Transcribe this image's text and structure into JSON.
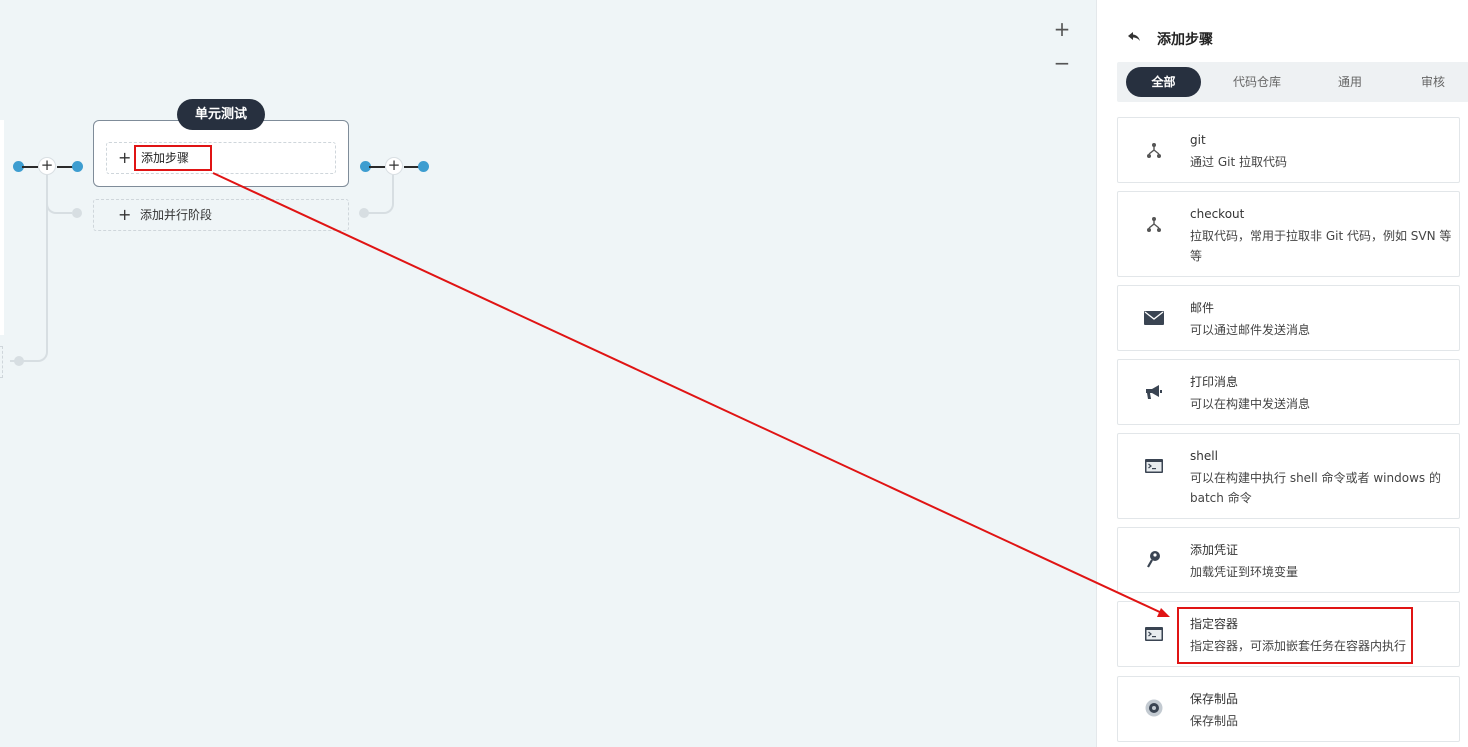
{
  "canvas": {
    "zoom_in": "+",
    "zoom_out": "−",
    "stage": {
      "title": "单元测试",
      "add_step_label": "添加步骤",
      "add_parallel_label": "添加并行阶段"
    }
  },
  "panel": {
    "title": "添加步骤",
    "tabs": [
      {
        "label": "全部",
        "active": true
      },
      {
        "label": "代码仓库",
        "active": false
      },
      {
        "label": "通用",
        "active": false
      },
      {
        "label": "审核",
        "active": false
      }
    ],
    "items": [
      {
        "name": "git",
        "desc": "通过 Git 拉取代码",
        "icon": "git-branch-icon"
      },
      {
        "name": "checkout",
        "desc": "拉取代码，常用于拉取非 Git 代码，例如 SVN 等等",
        "icon": "git-branch-icon"
      },
      {
        "name": "邮件",
        "desc": "可以通过邮件发送消息",
        "icon": "mail-icon"
      },
      {
        "name": "打印消息",
        "desc": "可以在构建中发送消息",
        "icon": "megaphone-icon"
      },
      {
        "name": "shell",
        "desc": "可以在构建中执行 shell 命令或者 windows 的 batch 命令",
        "icon": "terminal-icon"
      },
      {
        "name": "添加凭证",
        "desc": "加载凭证到环境变量",
        "icon": "key-icon"
      },
      {
        "name": "指定容器",
        "desc": "指定容器，可添加嵌套任务在容器内执行",
        "icon": "terminal-icon"
      },
      {
        "name": "保存制品",
        "desc": "保存制品",
        "icon": "disc-icon"
      }
    ]
  },
  "annotation": {
    "color": "#e01414"
  }
}
